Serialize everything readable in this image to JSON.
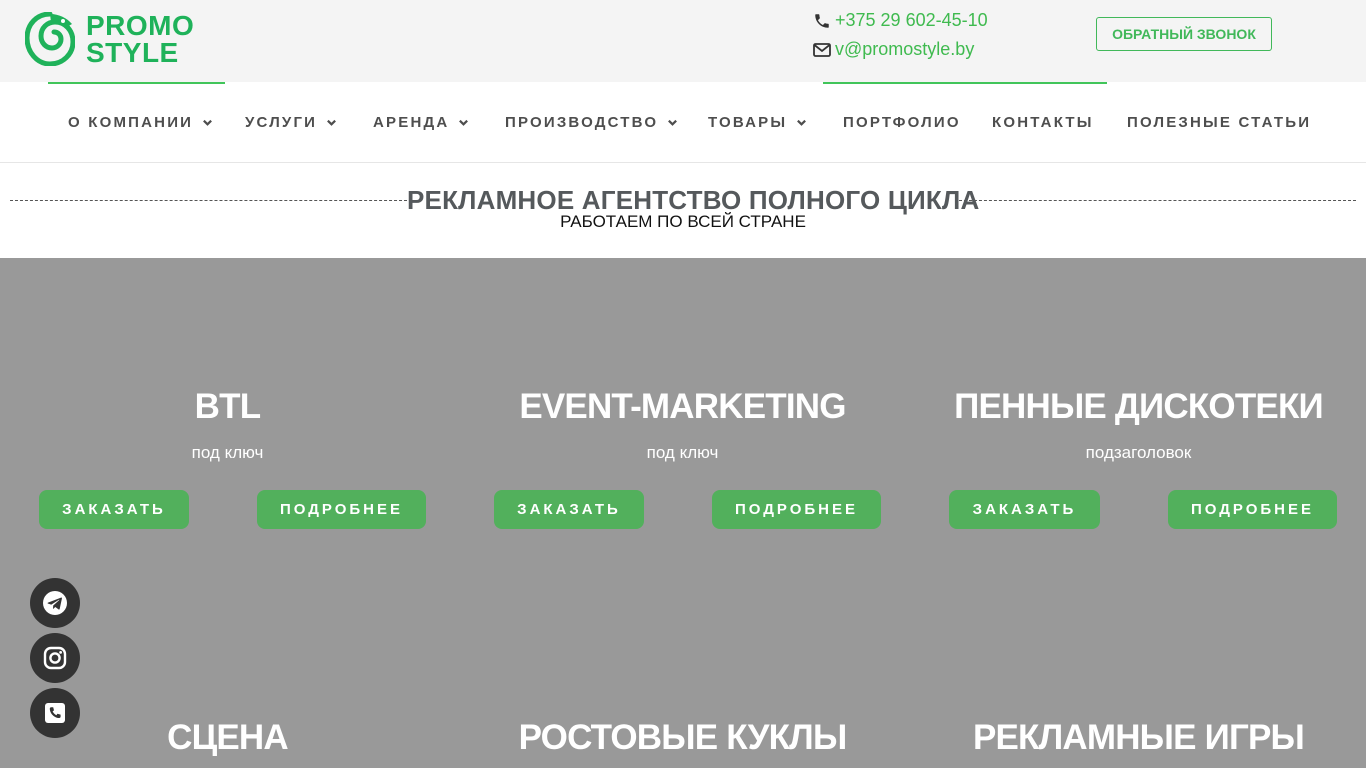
{
  "logo": {
    "line1": "PROMO",
    "line2": "STYLE"
  },
  "contacts": {
    "phone": "+375 29 602-45-10",
    "email": "v@promostyle.by"
  },
  "callback_label": "ОБРАТНЫЙ ЗВОНОК",
  "nav": {
    "items": [
      {
        "label": "О КОМПАНИИ"
      },
      {
        "label": "УСЛУГИ"
      },
      {
        "label": "АРЕНДА"
      },
      {
        "label": "ПРОИЗВОДСТВО"
      },
      {
        "label": "ТОВАРЫ"
      },
      {
        "label": "ПОРТФОЛИО"
      },
      {
        "label": "КОНТАКТЫ"
      },
      {
        "label": "ПОЛЕЗНЫЕ СТАТЬИ"
      }
    ]
  },
  "heading": {
    "title": "РЕКЛАМНОЕ АГЕНТСТВО ПОЛНОГО ЦИКЛА",
    "subtitle": "РАБОТАЕМ ПО ВСЕЙ СТРАНЕ"
  },
  "cards": [
    {
      "title": "BTL",
      "subtitle": "под ключ",
      "order_label": "ЗАКАЗАТЬ",
      "more_label": "ПОДРОБНЕЕ"
    },
    {
      "title": "EVENT-MARKETING",
      "subtitle": "под ключ",
      "order_label": "ЗАКАЗАТЬ",
      "more_label": "ПОДРОБНЕЕ"
    },
    {
      "title": "ПЕННЫЕ ДИСКОТЕКИ",
      "subtitle": "подзаголовок",
      "order_label": "ЗАКАЗАТЬ",
      "more_label": "ПОДРОБНЕЕ"
    },
    {
      "title": "СЦЕНА"
    },
    {
      "title": "РОСТОВЫЕ КУКЛЫ"
    },
    {
      "title": "РЕКЛАМНЫЕ ИГРЫ"
    }
  ],
  "social": [
    {
      "icon": "telegram-icon"
    },
    {
      "icon": "instagram-icon"
    },
    {
      "icon": "phone-square-icon"
    }
  ],
  "colors": {
    "brand_green": "#1fb25a",
    "button_green": "#52b05c",
    "hero_gray": "#999999",
    "social_dark": "#333333"
  }
}
